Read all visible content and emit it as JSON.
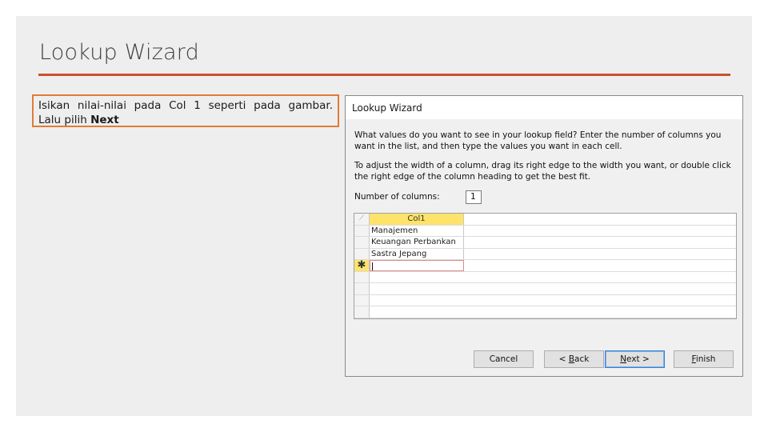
{
  "slide": {
    "title": "Lookup Wizard",
    "instruction": {
      "line1": "Isikan nilai-nilai pada Col 1 seperti pada gambar.",
      "line2_prefix": "Lalu pilih ",
      "line2_bold": "Next"
    },
    "accent_color": "#c8522f",
    "box_border_color": "#e07b39"
  },
  "dialog": {
    "title": "Lookup Wizard",
    "paragraph1": "What values do you want to see in your lookup field? Enter the number of columns you want in the list, and then type the values you want in each cell.",
    "paragraph2": "To adjust the width of a column, drag its right edge to the width you want, or double click the right edge of the column heading to get the best fit.",
    "num_columns_label": "Number of columns:",
    "num_columns_value": "1",
    "grid": {
      "column_header": "Col1",
      "rows": [
        "Manajemen",
        "Keuangan Perbankan",
        "Sastra Jepang"
      ],
      "new_row_marker": "✱"
    },
    "buttons": {
      "cancel": "Cancel",
      "back_prefix": "< ",
      "back_underlined": "B",
      "back_rest": "ack",
      "next_underlined": "N",
      "next_rest": "ext >",
      "finish_underlined": "F",
      "finish_rest": "inish"
    }
  }
}
